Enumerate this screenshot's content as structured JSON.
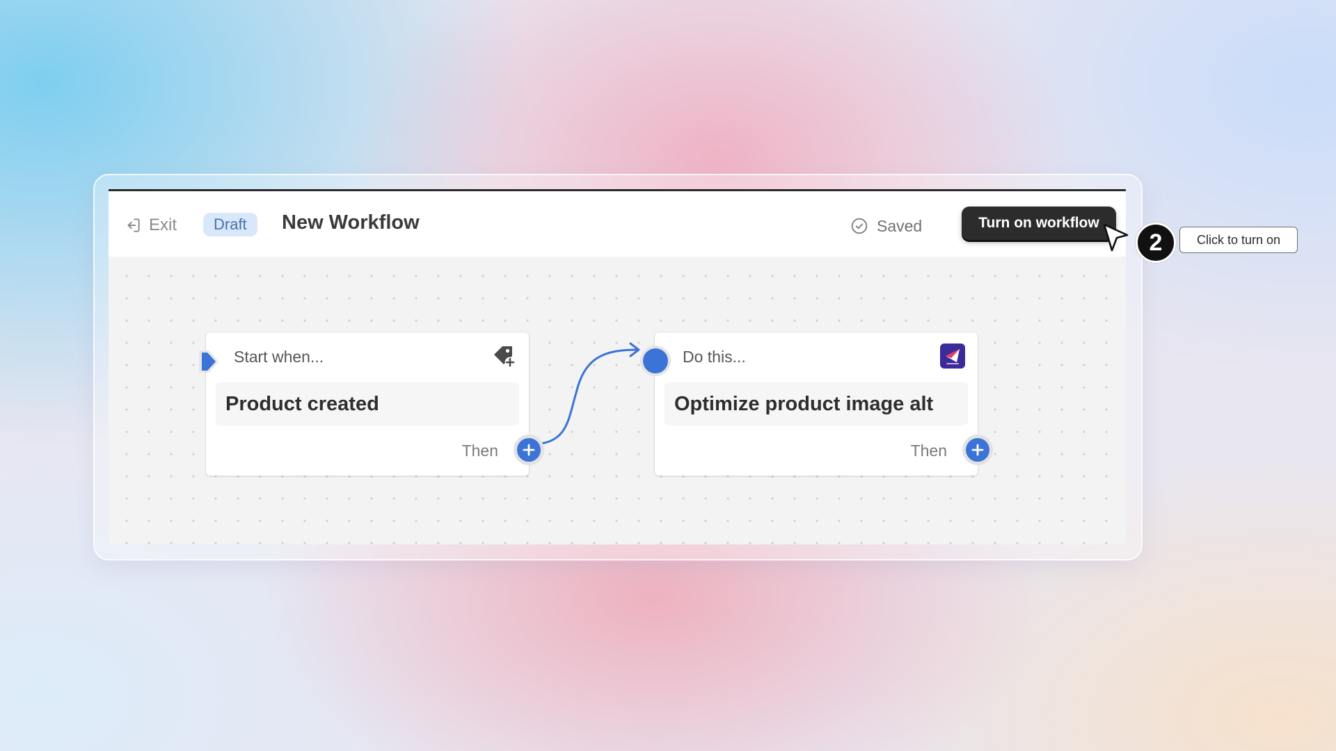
{
  "header": {
    "exit_label": "Exit",
    "status_badge": "Draft",
    "title": "New Workflow",
    "saved_label": "Saved",
    "primary_button": "Turn on workflow"
  },
  "nodes": [
    {
      "label": "Start when...",
      "value": "Product created",
      "then_label": "Then",
      "icon": "tag-plus-icon"
    },
    {
      "label": "Do this...",
      "value": "Optimize product image alt",
      "then_label": "Then",
      "icon": "app-logo-icon"
    }
  ],
  "annotation": {
    "step_number": "2",
    "tooltip": "Click to turn on"
  },
  "colors": {
    "accent": "#3b73d6",
    "primary_button_bg": "#2c2c2c",
    "draft_badge_bg": "#d9e7fb",
    "app_logo_bg": "#3b2a9a"
  }
}
